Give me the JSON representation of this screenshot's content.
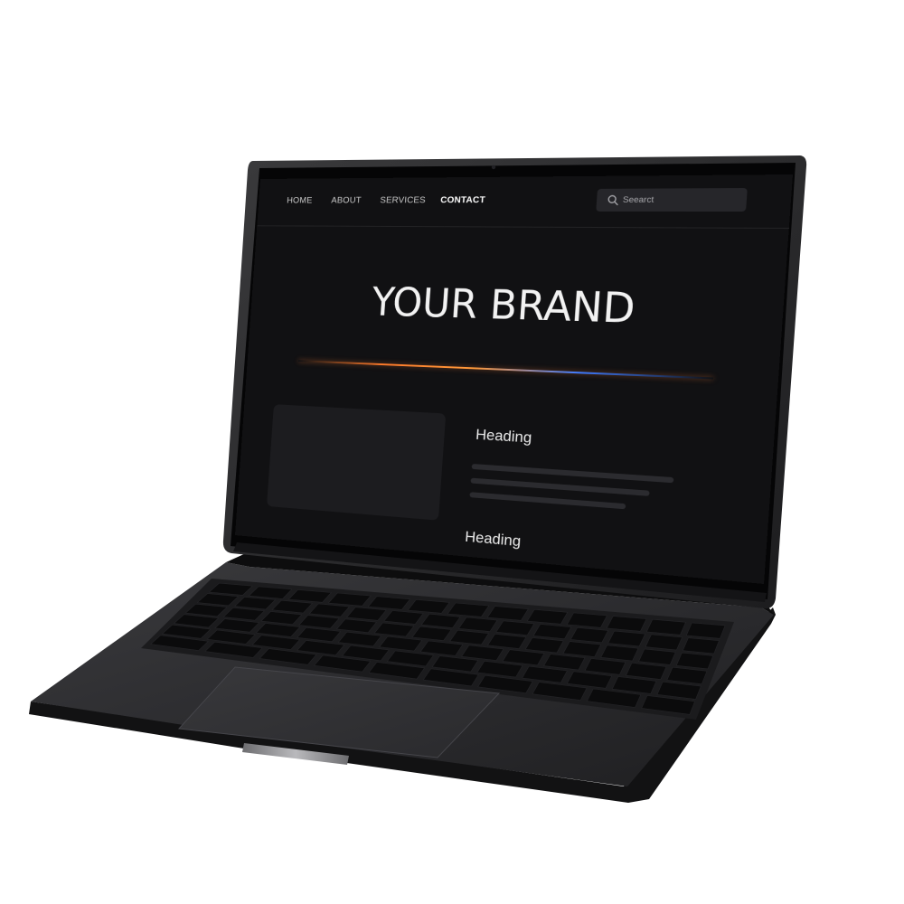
{
  "nav": {
    "items": [
      {
        "label": "HOME",
        "active": false
      },
      {
        "label": "ABOUT",
        "active": false
      },
      {
        "label": "SERVICES",
        "active": false
      },
      {
        "label": "CONTACT",
        "active": true
      }
    ]
  },
  "search": {
    "placeholder": "Seearct",
    "icon": "search-icon"
  },
  "hero": {
    "title": "YOUR BRAND",
    "divider_colors": [
      "#ff7a2a",
      "#3f7bff"
    ]
  },
  "content": {
    "heading_1": "Heading",
    "heading_2": "Heading"
  },
  "colors": {
    "laptop_body": "#2a2a2c",
    "screen_background": "#111113",
    "accent_orange": "#ff7a2a",
    "accent_blue": "#3f7bff"
  }
}
